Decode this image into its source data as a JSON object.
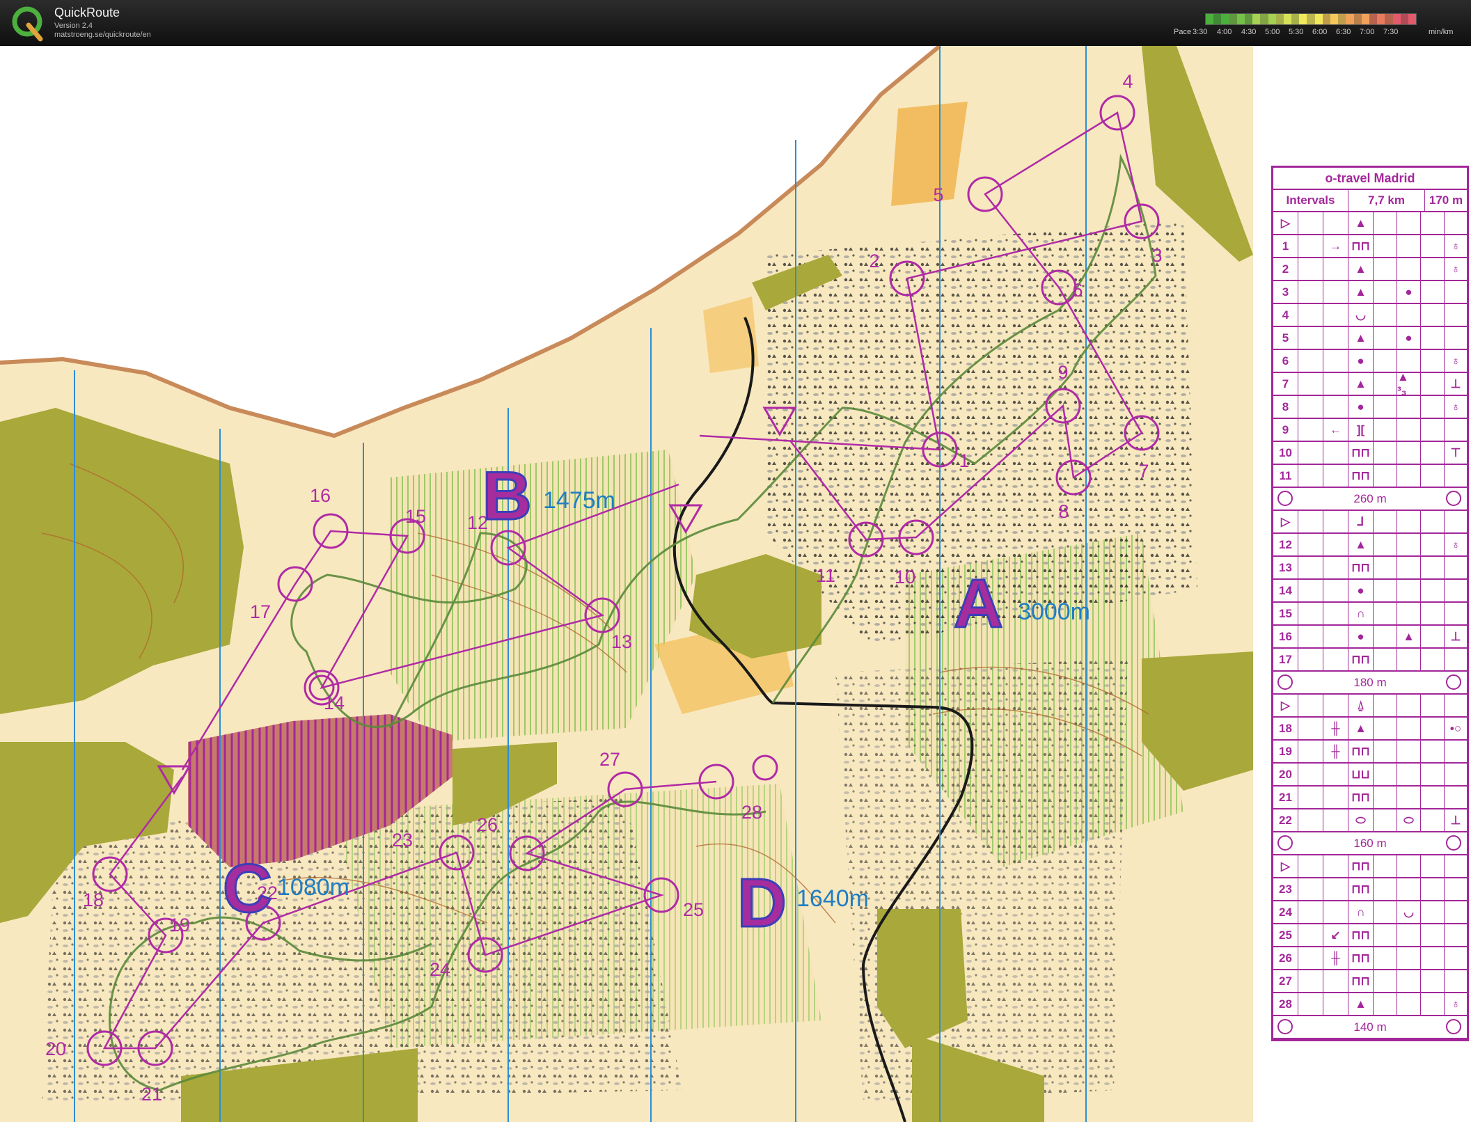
{
  "app": {
    "name": "QuickRoute",
    "version": "Version 2.4",
    "url": "matstroeng.se/quickroute/en",
    "logo_letter": "Q"
  },
  "pace_scale": {
    "label_prefix": "Pace",
    "labels": [
      "3:30",
      "4:00",
      "4:30",
      "5:00",
      "5:30",
      "6:00",
      "6:30",
      "7:00",
      "7:30"
    ],
    "unit": "min/km",
    "colors": [
      "#4caf3e",
      "#76c04a",
      "#a6d153",
      "#d6e35a",
      "#f2e85c",
      "#f5c85a",
      "#f0a15a",
      "#e97a5e",
      "#e35a6a"
    ]
  },
  "map": {
    "controls": [
      {
        "n": "1"
      },
      {
        "n": "2"
      },
      {
        "n": "3"
      },
      {
        "n": "4"
      },
      {
        "n": "5"
      },
      {
        "n": "6"
      },
      {
        "n": "7"
      },
      {
        "n": "8"
      },
      {
        "n": "9"
      },
      {
        "n": "10"
      },
      {
        "n": "11"
      },
      {
        "n": "12"
      },
      {
        "n": "13"
      },
      {
        "n": "14"
      },
      {
        "n": "15"
      },
      {
        "n": "16"
      },
      {
        "n": "17"
      },
      {
        "n": "18"
      },
      {
        "n": "19"
      },
      {
        "n": "20"
      },
      {
        "n": "21"
      },
      {
        "n": "22"
      },
      {
        "n": "23"
      },
      {
        "n": "24"
      },
      {
        "n": "25"
      },
      {
        "n": "26"
      },
      {
        "n": "27"
      },
      {
        "n": "28"
      }
    ],
    "legs": [
      {
        "letter": "A",
        "distance": "3000m"
      },
      {
        "letter": "B",
        "distance": "1475m"
      },
      {
        "letter": "C",
        "distance": "1080m"
      },
      {
        "letter": "D",
        "distance": "1640m"
      }
    ],
    "colors": {
      "course": "#b02aa6",
      "forest": "#a9a83a",
      "open": "#f7d28e",
      "meridian": "#2a8ed6"
    }
  },
  "description_sheet": {
    "event": "o-travel Madrid",
    "header": {
      "col1": "Intervals",
      "col2": "7,7 km",
      "col3": "170 m"
    },
    "sections": [
      {
        "start_symbol": "▲",
        "rows": [
          {
            "n": "1",
            "c": "→",
            "d": "⊓⊓",
            "g": "",
            "h": "♁"
          },
          {
            "n": "2",
            "c": "",
            "d": "▲",
            "g": "",
            "h": "♁"
          },
          {
            "n": "3",
            "c": "",
            "d": "▲",
            "g": "●",
            "h": ""
          },
          {
            "n": "4",
            "c": "",
            "d": "◡",
            "g": "",
            "h": ""
          },
          {
            "n": "5",
            "c": "",
            "d": "▲",
            "g": "●",
            "h": ""
          },
          {
            "n": "6",
            "c": "",
            "d": "●",
            "g": "",
            "h": "♁"
          },
          {
            "n": "7",
            "c": "",
            "d": "▲",
            "g": "▲ ³₃",
            "h": "⊥"
          },
          {
            "n": "8",
            "c": "",
            "d": "●",
            "g": "",
            "h": "♁"
          },
          {
            "n": "9",
            "c": "←",
            "d": "][",
            "g": "",
            "h": ""
          },
          {
            "n": "10",
            "c": "",
            "d": "⊓⊓",
            "g": "",
            "h": "⊤"
          },
          {
            "n": "11",
            "c": "",
            "d": "⊓⊓",
            "g": "",
            "h": ""
          }
        ],
        "distance": "260 m"
      },
      {
        "start_symbol": "⅃",
        "rows": [
          {
            "n": "12",
            "c": "",
            "d": "▲",
            "g": "",
            "h": "♁"
          },
          {
            "n": "13",
            "c": "",
            "d": "⊓⊓",
            "g": "",
            "h": ""
          },
          {
            "n": "14",
            "c": "",
            "d": "●",
            "g": "",
            "h": ""
          },
          {
            "n": "15",
            "c": "",
            "d": "∩",
            "g": "",
            "h": ""
          },
          {
            "n": "16",
            "c": "",
            "d": "●",
            "g": "▲",
            "h": "⊥"
          },
          {
            "n": "17",
            "c": "",
            "d": "⊓⊓",
            "g": "",
            "h": ""
          }
        ],
        "distance": "180 m"
      },
      {
        "start_symbol": "⍙",
        "rows": [
          {
            "n": "18",
            "c": "╫",
            "d": "▲",
            "g": "",
            "h": "•○"
          },
          {
            "n": "19",
            "c": "╫",
            "d": "⊓⊓",
            "g": "",
            "h": ""
          },
          {
            "n": "20",
            "c": "",
            "d": "⊔⊔",
            "g": "",
            "h": ""
          },
          {
            "n": "21",
            "c": "",
            "d": "⊓⊓",
            "g": "",
            "h": ""
          },
          {
            "n": "22",
            "c": "",
            "d": "⬭",
            "g": "⬭",
            "h": "⊥"
          }
        ],
        "distance": "160 m"
      },
      {
        "start_symbol": "⊓⊓",
        "rows": [
          {
            "n": "23",
            "c": "",
            "d": "⊓⊓",
            "g": "",
            "h": ""
          },
          {
            "n": "24",
            "c": "",
            "d": "∩",
            "g": "◡",
            "h": ""
          },
          {
            "n": "25",
            "c": "↙",
            "d": "⊓⊓",
            "g": "",
            "h": ""
          },
          {
            "n": "26",
            "c": "╫",
            "d": "⊓⊓",
            "g": "",
            "h": ""
          },
          {
            "n": "27",
            "c": "",
            "d": "⊓⊓",
            "g": "",
            "h": ""
          },
          {
            "n": "28",
            "c": "",
            "d": "▲",
            "g": "",
            "h": "♁"
          }
        ],
        "distance": "140 m"
      }
    ]
  }
}
